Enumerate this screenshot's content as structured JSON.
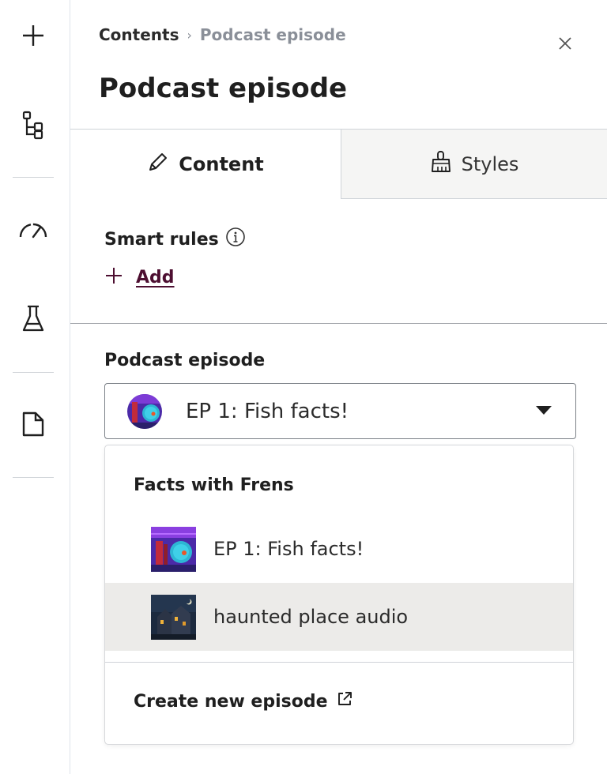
{
  "rail": {
    "icons": [
      "plus-icon",
      "tree-icon",
      "gauge-icon",
      "flask-icon",
      "page-icon"
    ]
  },
  "header": {
    "breadcrumb_root": "Contents",
    "breadcrumb_separator": "›",
    "breadcrumb_current": "Podcast episode",
    "title": "Podcast episode",
    "close_icon": "close-icon"
  },
  "tabs": [
    {
      "label": "Content",
      "icon": "pencil-icon",
      "active": true
    },
    {
      "label": "Styles",
      "icon": "brush-icon",
      "active": false
    }
  ],
  "smart_rules": {
    "heading": "Smart rules",
    "info_icon": "info-icon",
    "add_label": "Add"
  },
  "episode_field": {
    "label": "Podcast episode",
    "selected": "EP 1: Fish facts!"
  },
  "dropdown": {
    "group_label": "Facts with Frens",
    "options": [
      {
        "label": "EP 1: Fish facts!",
        "highlighted": false
      },
      {
        "label": "haunted place audio",
        "highlighted": true
      }
    ],
    "create_label": "Create new episode",
    "create_icon": "external-link-icon"
  },
  "colors": {
    "accent_link": "#4d0f31",
    "highlight_bg": "#ecebe9",
    "inactive_tab_bg": "#f5f5f4"
  }
}
